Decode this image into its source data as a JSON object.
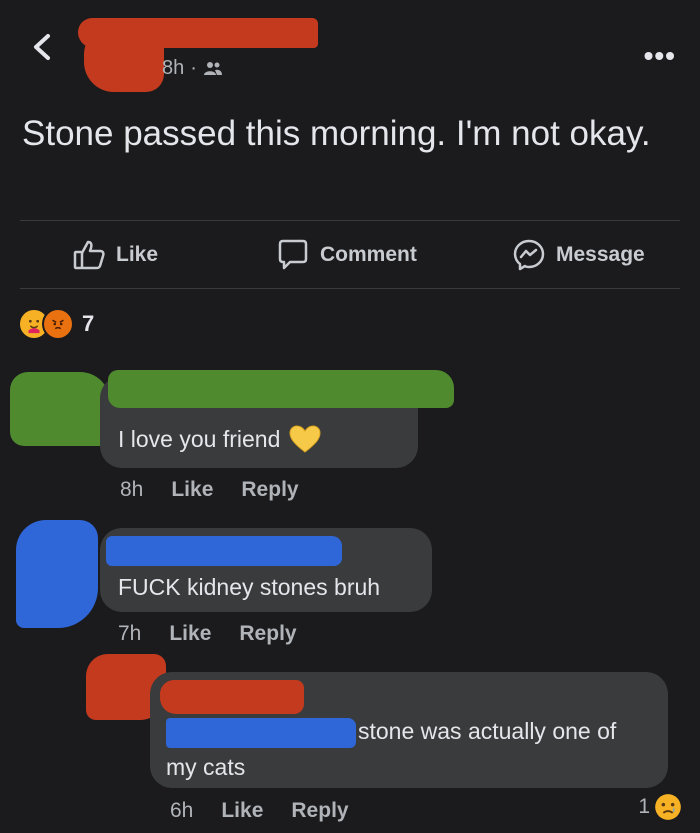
{
  "header": {
    "time": "8h",
    "separator": "·",
    "audience_icon": "friends-icon",
    "more_label": "•••"
  },
  "post": {
    "text": "Stone passed this morning. I'm not okay."
  },
  "actions": {
    "like": "Like",
    "comment": "Comment",
    "message": "Message"
  },
  "reactions": {
    "count": "7",
    "emojis": [
      "care",
      "angry"
    ]
  },
  "comments": [
    {
      "text": "I love you friend",
      "time": "8h",
      "like": "Like",
      "reply": "Reply"
    },
    {
      "text": "FUCK kidney stones bruh",
      "time": "7h",
      "like": "Like",
      "reply": "Reply"
    },
    {
      "text_line1": "stone was actually one of",
      "text_line2": "my cats",
      "time": "6h",
      "like": "Like",
      "reply": "Reply",
      "reaction_count": "1"
    }
  ],
  "colors": {
    "background": "#1b1b1d",
    "bubble": "#3a3b3c",
    "redact_red": "#c43a1f",
    "redact_green": "#4f8a2f",
    "redact_blue": "#2f66d8"
  }
}
